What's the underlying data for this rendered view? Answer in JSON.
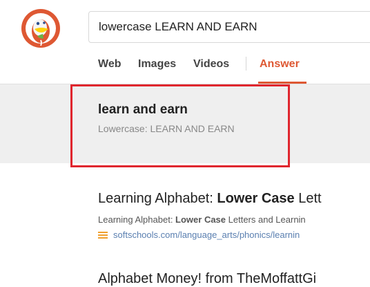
{
  "search": {
    "query": "lowercase LEARN AND EARN"
  },
  "nav": {
    "tabs": [
      "Web",
      "Images",
      "Videos",
      "Answer"
    ],
    "active": "Answer"
  },
  "answer": {
    "title": "learn and earn",
    "subtitle": "Lowercase: LEARN AND EARN"
  },
  "results": [
    {
      "title_prefix": "Learning Alphabet: ",
      "title_bold": "Lower Case",
      "title_suffix": " Lett",
      "snippet_prefix": "Learning Alphabet: ",
      "snippet_bold": "Lower Case",
      "snippet_suffix": " Letters and Learnin",
      "url": "softschools.com/language_arts/phonics/learnin"
    },
    {
      "title": "Alphabet Money! from TheMoffattGi"
    }
  ],
  "colors": {
    "accent": "#de5833",
    "highlight": "#e0262e",
    "panel": "#efefef",
    "url": "#5a7fb0"
  }
}
